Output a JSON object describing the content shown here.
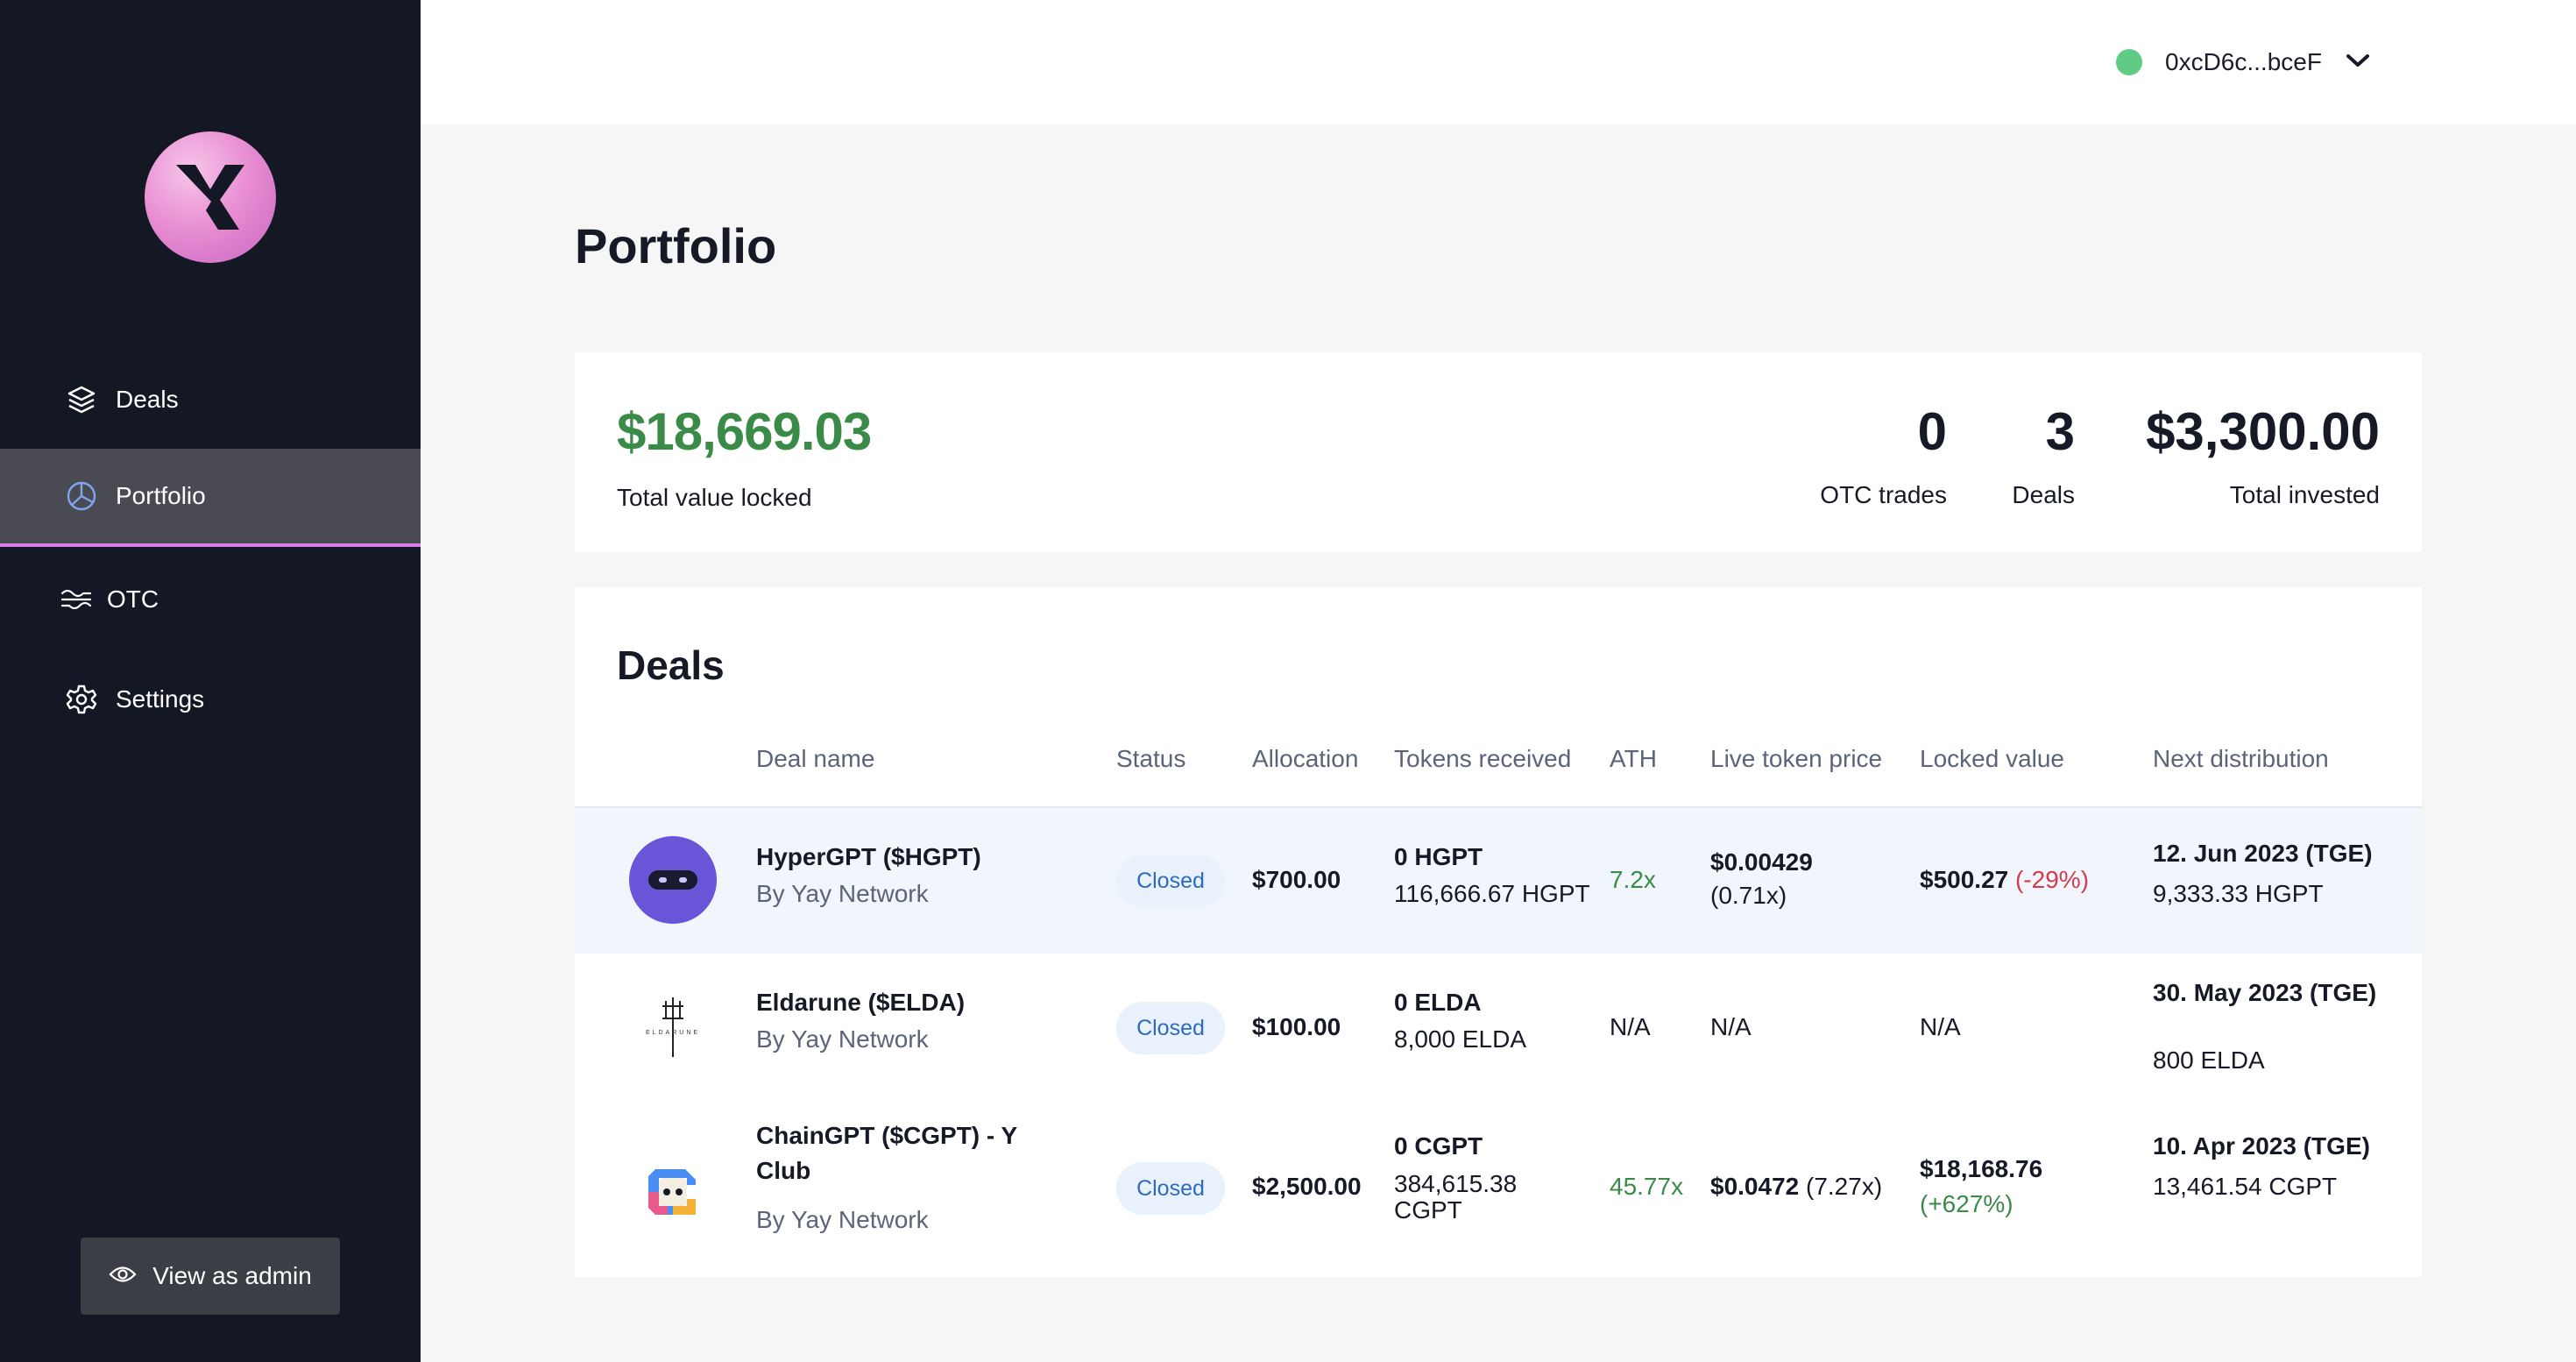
{
  "colors": {
    "sidebar_bg": "#141824",
    "active_nav_bg": "#4a4b52",
    "active_underline": "#d57ce6",
    "positive": "#3a8a48",
    "negative": "#d63a4c",
    "badge_text": "#2e6bbf",
    "wallet_status": "#5fcb85"
  },
  "sidebar": {
    "logo": "Y-logo",
    "items": [
      {
        "label": "Deals",
        "icon": "layers-icon"
      },
      {
        "label": "Portfolio",
        "icon": "pie-chart-icon",
        "active": true
      },
      {
        "label": "OTC",
        "icon": "swap-icon"
      },
      {
        "label": "Settings",
        "icon": "gear-icon"
      }
    ],
    "admin_button": {
      "label": "View as admin",
      "icon": "eye-icon"
    }
  },
  "header": {
    "wallet_address": "0xcD6c...bceF",
    "dropdown_icon": "chevron-down-icon"
  },
  "page": {
    "title": "Portfolio"
  },
  "summary": {
    "total_value_locked": "$18,669.03",
    "total_value_locked_label": "Total value locked",
    "otc_trades": "0",
    "otc_trades_label": "OTC trades",
    "deals": "3",
    "deals_label": "Deals",
    "total_invested": "$3,300.00",
    "total_invested_label": "Total invested"
  },
  "deals_table": {
    "title": "Deals",
    "columns": [
      "Deal name",
      "Status",
      "Allocation",
      "Tokens received",
      "ATH",
      "Live token price",
      "Locked value",
      "Next distribution"
    ],
    "rows": [
      {
        "name": "HyperGPT ($HGPT)",
        "by": "By Yay Network",
        "status": "Closed",
        "allocation": "$700.00",
        "tokens_line1": "0 HGPT",
        "tokens_line2": "116,666.67 HGPT",
        "ath": "7.2x",
        "price_main": "$0.00429",
        "price_mult": "(0.71x)",
        "locked_main": "$500.27",
        "locked_change": "(-29%)",
        "next_date": "12. Jun 2023 (TGE)",
        "next_amount": "9,333.33 HGPT"
      },
      {
        "name": "Eldarune ($ELDA)",
        "by": "By Yay Network",
        "status": "Closed",
        "allocation": "$100.00",
        "tokens_line1": "0 ELDA",
        "tokens_line2": "8,000 ELDA",
        "ath": "N/A",
        "price_main": "N/A",
        "locked_main": "N/A",
        "next_date": "30. May 2023 (TGE)",
        "next_amount": "800 ELDA",
        "logo_text": "ELDARUNE"
      },
      {
        "name": "ChainGPT ($CGPT) - Y Club",
        "by": "By Yay Network",
        "status": "Closed",
        "allocation": "$2,500.00",
        "tokens_line1": "0 CGPT",
        "tokens_line2": "384,615.38 CGPT",
        "ath": "45.77x",
        "price_main": "$0.0472",
        "price_mult": "(7.27x)",
        "locked_main": "$18,168.76",
        "locked_change": "(+627%)",
        "next_date": "10. Apr 2023 (TGE)",
        "next_amount": "13,461.54 CGPT"
      }
    ]
  }
}
